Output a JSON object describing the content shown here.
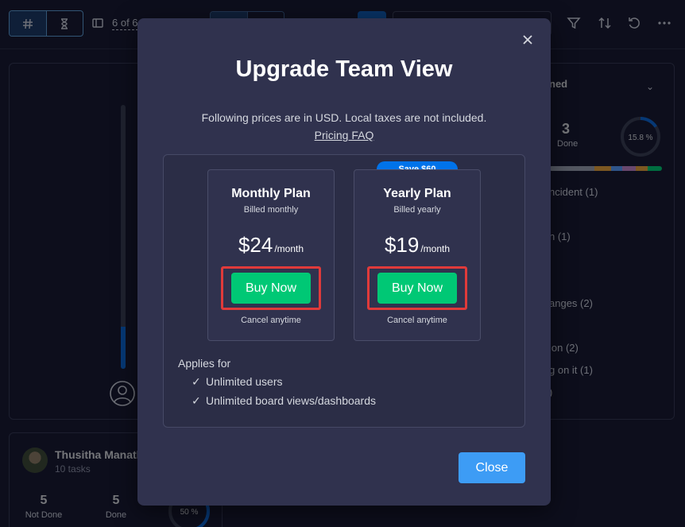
{
  "toolbar": {
    "item_count": "6 of 6",
    "icons": [
      "hash-icon",
      "hourglass-icon",
      "sidebar-toggle-icon",
      "filter-icon",
      "sort-icon",
      "undo-icon",
      "more-icon"
    ]
  },
  "right_panel": {
    "title_fragment": "ned",
    "done_count": "3",
    "done_label": "Done",
    "progress_text": "15.8 %",
    "progress": 0.158,
    "items": [
      "ncident (1)",
      "n (1)",
      "anges (2)",
      "ion (2)",
      "g on it (1)",
      ")"
    ]
  },
  "bottom_panel": {
    "user_name": "Thusitha Manatl",
    "task_count": "10 tasks",
    "not_done_count": "5",
    "not_done_label": "Not Done",
    "done_count": "5",
    "done_label": "Done",
    "ring_text": "50 %"
  },
  "modal": {
    "title": "Upgrade Team View",
    "note": "Following prices are in USD. Local taxes are not included.",
    "faq_link": "Pricing FAQ",
    "plans": [
      {
        "name": "Monthly Plan",
        "billed": "Billed monthly",
        "price": "$24",
        "per": "/month",
        "buy_label": "Buy Now",
        "cancel": "Cancel anytime"
      },
      {
        "name": "Yearly Plan",
        "billed": "Billed yearly",
        "price": "$19",
        "per": "/month",
        "buy_label": "Buy Now",
        "cancel": "Cancel anytime",
        "badge": "Save $60"
      }
    ],
    "applies_for": "Applies for",
    "features": [
      "Unlimited users",
      "Unlimited board views/dashboards"
    ],
    "close_label": "Close"
  },
  "colors": {
    "buy_green": "#00c875",
    "close_blue": "#3d9cf5",
    "badge_blue": "#0073ea",
    "highlight_red": "#e03a3a"
  }
}
